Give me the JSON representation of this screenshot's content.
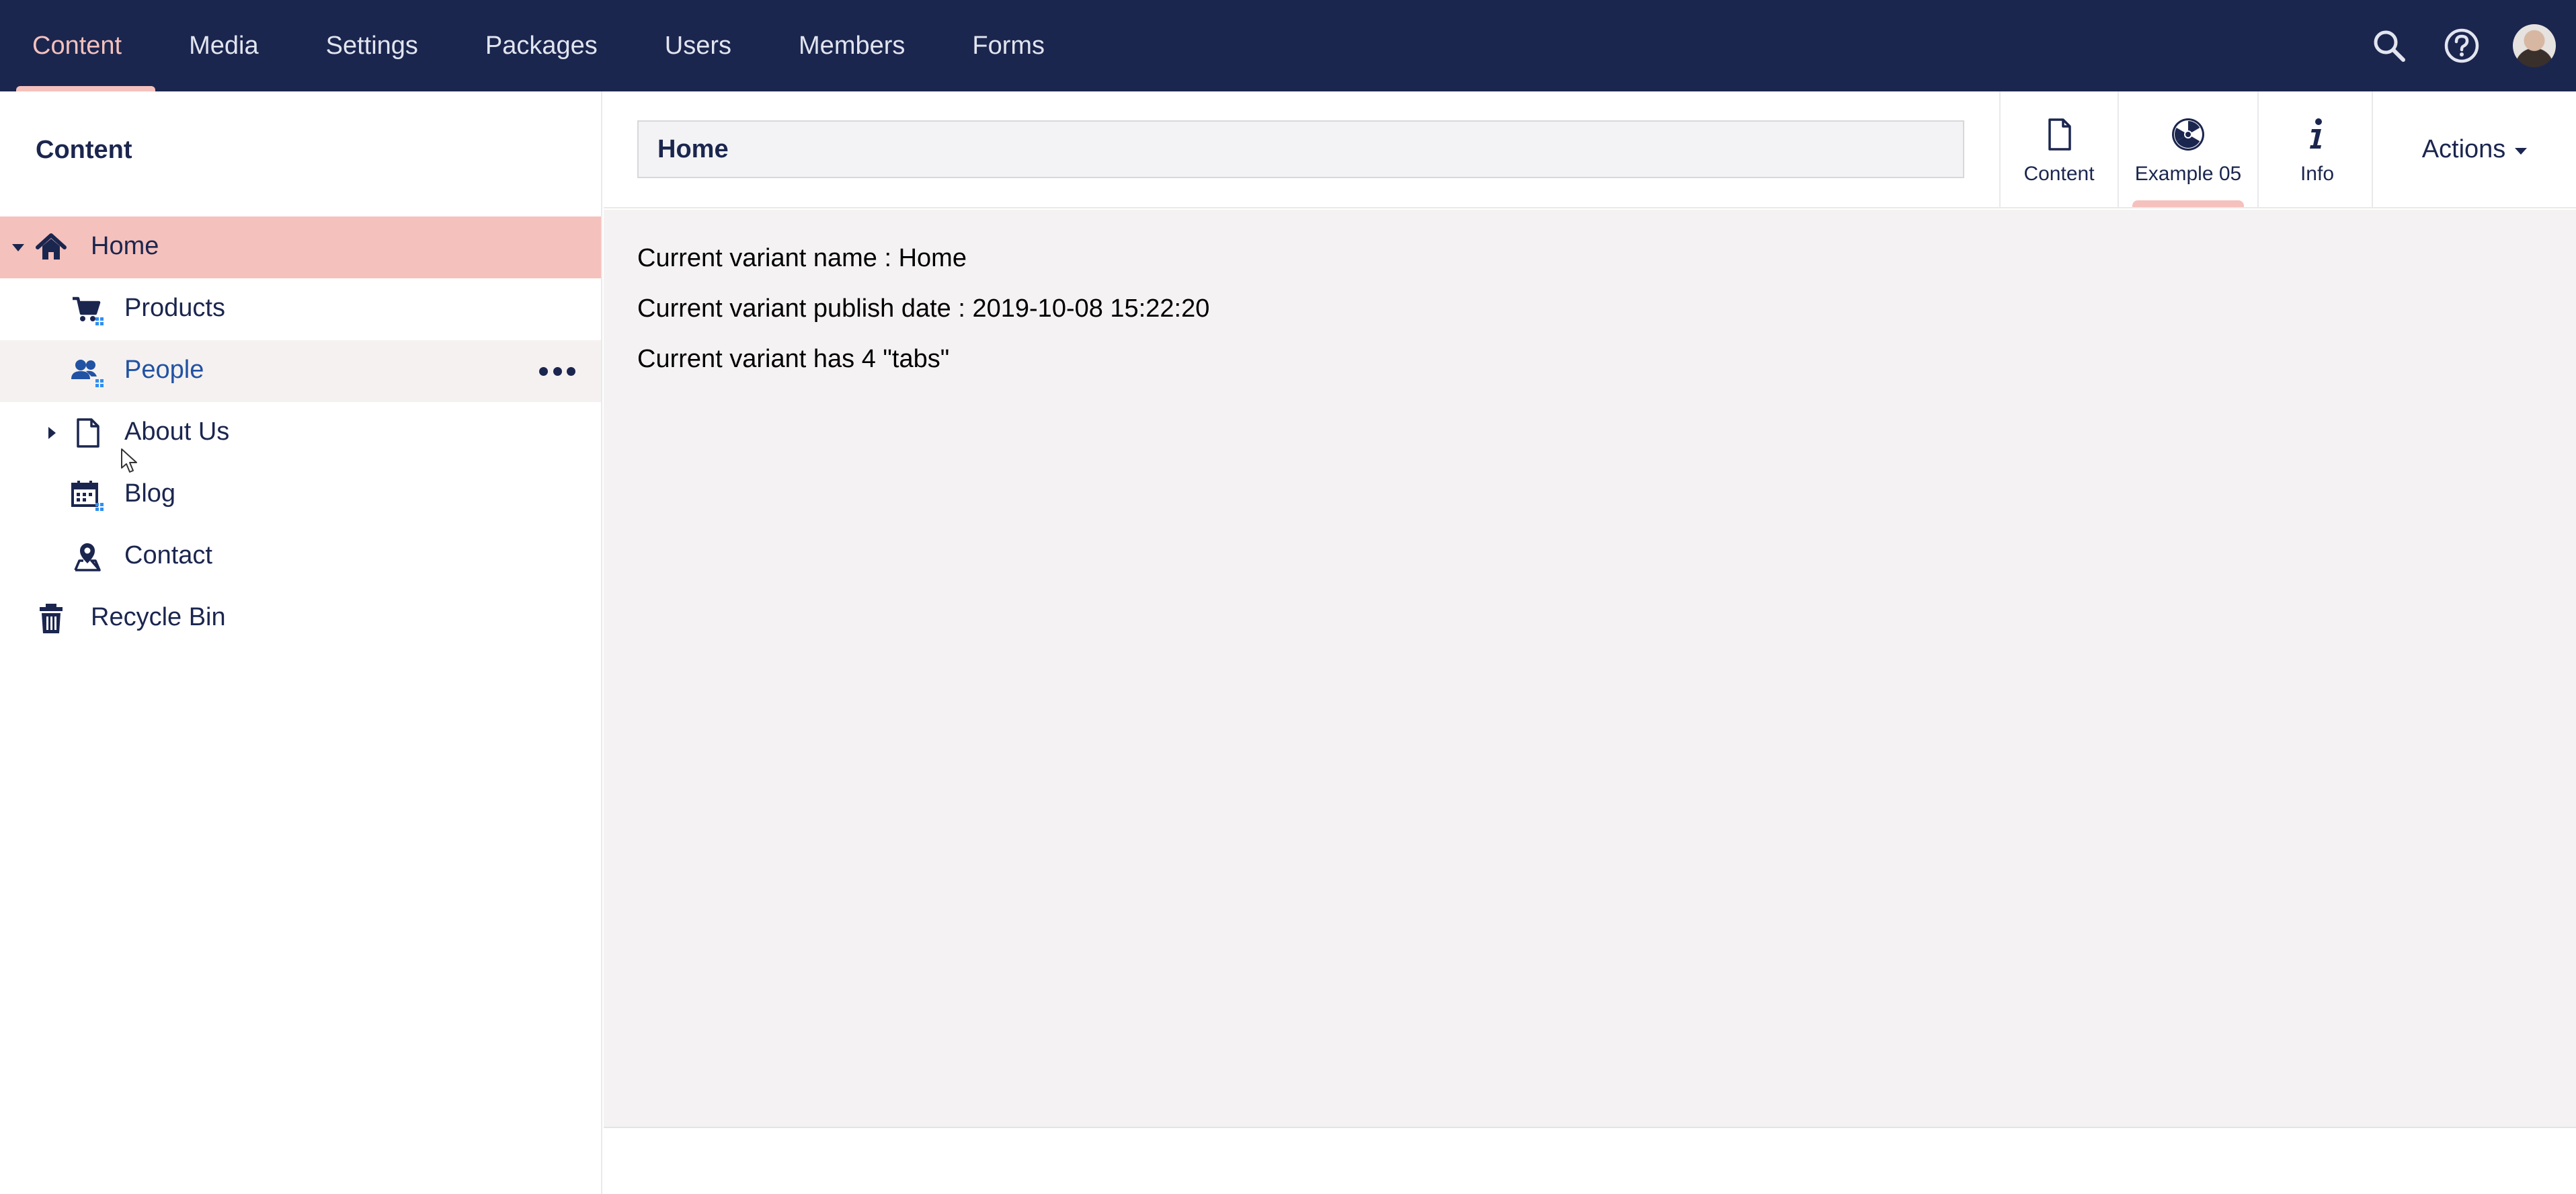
{
  "topnav": {
    "items": [
      {
        "label": "Content"
      },
      {
        "label": "Media"
      },
      {
        "label": "Settings"
      },
      {
        "label": "Packages"
      },
      {
        "label": "Users"
      },
      {
        "label": "Members"
      },
      {
        "label": "Forms"
      }
    ],
    "active": "Content",
    "icons": [
      "search-icon",
      "help-icon",
      "avatar"
    ]
  },
  "sidebar": {
    "title": "Content",
    "tree": [
      {
        "label": "Home",
        "icon": "home-icon",
        "state": "selected",
        "expanded": true
      },
      {
        "label": "Products",
        "icon": "shopping-cart-icon"
      },
      {
        "label": "People",
        "icon": "users-icon",
        "state": "hover"
      },
      {
        "label": "About Us",
        "icon": "document-icon",
        "expandable": true
      },
      {
        "label": "Blog",
        "icon": "calendar-icon"
      },
      {
        "label": "Contact",
        "icon": "map-pin-icon"
      },
      {
        "label": "Recycle Bin",
        "icon": "trash-icon"
      }
    ]
  },
  "editor": {
    "name_value": "Home",
    "apps": [
      {
        "label": "Content",
        "icon": "document-icon"
      },
      {
        "label": "Example 05",
        "icon": "radioactive-icon"
      },
      {
        "label": "Info",
        "icon": "info-icon"
      }
    ],
    "active_app": "Example 05",
    "actions_label": "Actions",
    "lines": [
      "Current variant name : Home",
      "Current variant publish date : 2019-10-08 15:22:20",
      "Current variant has 4 \"tabs\""
    ]
  },
  "colors": {
    "header_bg": "#1b264f",
    "accent": "#f5c1bc",
    "hover_text": "#2152a3",
    "body_bg": "#f4f2f2"
  }
}
